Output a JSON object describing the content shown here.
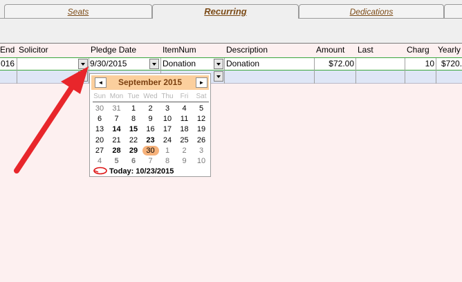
{
  "tabs": [
    {
      "label": "Seats"
    },
    {
      "label": "Recurring"
    },
    {
      "label": "Dedications"
    }
  ],
  "columns": {
    "end": "End",
    "solicitor": "Solicitor",
    "pledge_date": "Pledge Date",
    "itemnum": "ItemNum",
    "description": "Description",
    "amount": "Amount",
    "last": "Last",
    "charg": "Charg",
    "yearly": "Yearly"
  },
  "row": {
    "end": "016",
    "solicitor": "",
    "pledge_date": "9/30/2015",
    "itemnum": "Donation",
    "description": "Donation",
    "amount": "$72.00",
    "last": "",
    "charg": "10",
    "yearly": "$720."
  },
  "calendar": {
    "title": "September 2015",
    "prev_symbol": "◄",
    "next_symbol": "►",
    "weekdays": [
      "Sun",
      "Mon",
      "Tue",
      "Wed",
      "Thu",
      "Fri",
      "Sat"
    ],
    "weeks": [
      [
        "30",
        "31",
        "1",
        "2",
        "3",
        "4",
        "5"
      ],
      [
        "6",
        "7",
        "8",
        "9",
        "10",
        "11",
        "12"
      ],
      [
        "13",
        "14",
        "15",
        "16",
        "17",
        "18",
        "19"
      ],
      [
        "20",
        "21",
        "22",
        "23",
        "24",
        "25",
        "26"
      ],
      [
        "27",
        "28",
        "29",
        "30",
        "1",
        "2",
        "3"
      ],
      [
        "4",
        "5",
        "6",
        "7",
        "8",
        "9",
        "10"
      ]
    ],
    "selected": "30",
    "today_label": "Today: 10/23/2015"
  },
  "colors": {
    "tab_text": "#7b4a16",
    "calendar_header": "#fbcf9d",
    "selected_day": "#f6b27b",
    "arrow": "#e8262b",
    "background": "#fdf0f0"
  },
  "icons": {
    "dropdown": "chevron-down-icon",
    "prev": "arrow-left-icon",
    "next": "arrow-right-icon",
    "today": "today-circle-icon"
  }
}
